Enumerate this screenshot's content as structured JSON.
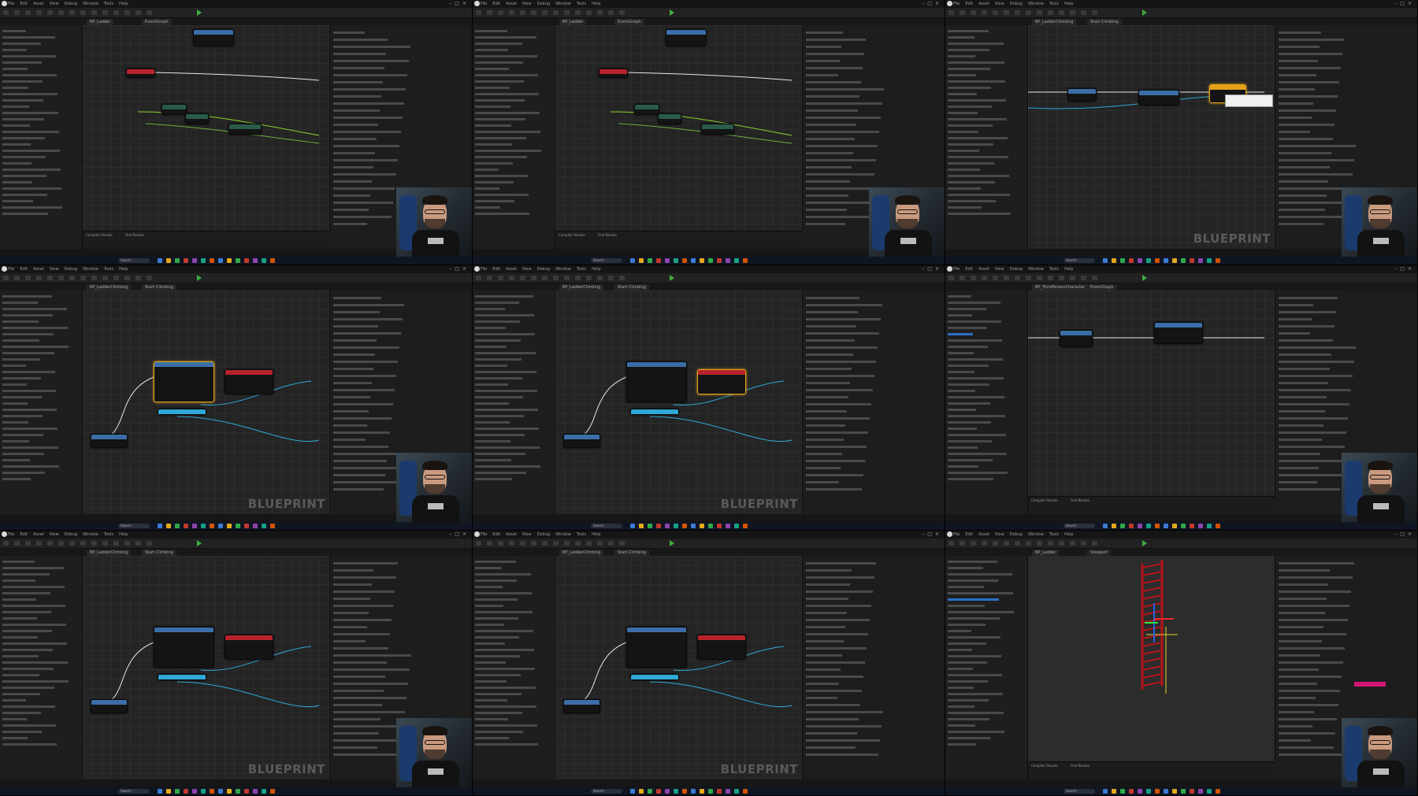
{
  "layout": {
    "columns": 3,
    "rows": 3
  },
  "menu_items": [
    "File",
    "Edit",
    "Asset",
    "View",
    "Debug",
    "Window",
    "Tools",
    "Help"
  ],
  "taskbar": {
    "search_placeholder": "Search"
  },
  "watermark": "BLUEPRINT",
  "tiles": [
    {
      "view": "graph",
      "webcam": true,
      "tabs": [
        "BP_Ladder",
        "EventGraph"
      ],
      "bottom_tabs": [
        "Compiler Results",
        "Find Results"
      ]
    },
    {
      "view": "graph",
      "webcam": true,
      "tabs": [
        "BP_Ladder",
        "EventGraph"
      ],
      "bottom_tabs": [
        "Compiler Results",
        "Find Results"
      ]
    },
    {
      "view": "graph",
      "webcam": true,
      "tabs": [
        "BP_LadderClimbing",
        "Start Climbing"
      ],
      "bottom_tabs": []
    },
    {
      "view": "graph",
      "webcam": true,
      "tabs": [
        "BP_LadderClimbing",
        "Start Climbing"
      ],
      "bottom_tabs": []
    },
    {
      "view": "graph",
      "webcam": false,
      "tabs": [
        "BP_LadderClimbing",
        "Start Climbing"
      ],
      "bottom_tabs": []
    },
    {
      "view": "graph",
      "webcam": true,
      "tabs": [
        "BP_ThirdPersonCharacter",
        "EventGraph"
      ],
      "bottom_tabs": [
        "Compiler Results",
        "Find Results"
      ]
    },
    {
      "view": "graph",
      "webcam": true,
      "tabs": [
        "BP_LadderClimbing",
        "Start Climbing"
      ],
      "bottom_tabs": []
    },
    {
      "view": "graph",
      "webcam": false,
      "tabs": [
        "BP_LadderClimbing",
        "Start Climbing"
      ],
      "bottom_tabs": []
    },
    {
      "view": "viewport",
      "webcam": true,
      "tabs": [
        "BP_Ladder",
        "Viewport"
      ],
      "bottom_tabs": [
        "Compiler Results",
        "Find Results"
      ]
    }
  ],
  "colors": {
    "exec_wire": "#e8e8e8",
    "object_wire": "#2fa9d6",
    "bool_wire": "#6fae3a",
    "float_wire": "#8ad42a",
    "event_header": "#b8232a",
    "function_header": "#3b6ea8",
    "pure_header": "#2a5c4a",
    "selection": "#e3a21a",
    "ladder": "#b3141a",
    "accent_magenta": "#d41673"
  }
}
